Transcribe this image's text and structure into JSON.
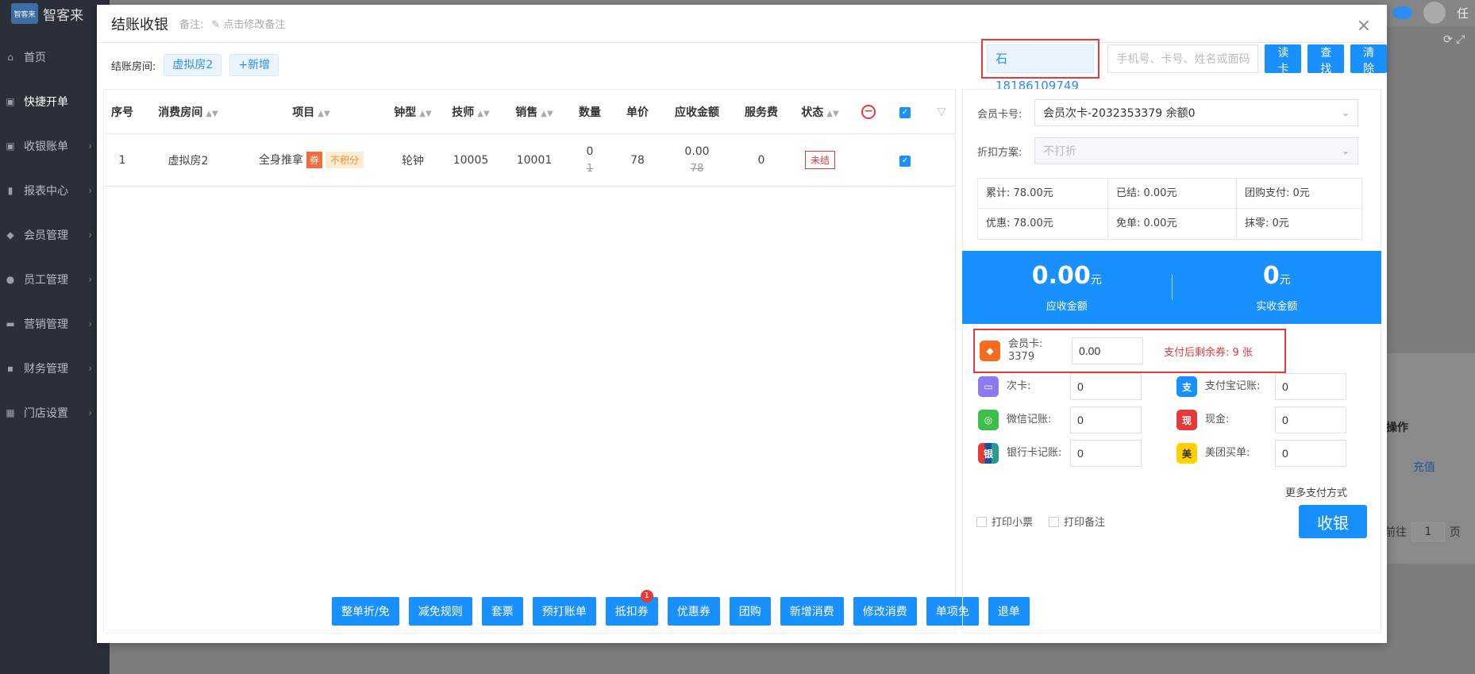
{
  "app": {
    "logo_badge": "智客来",
    "name": "智客来",
    "user_initial": "任",
    "sidebar": [
      {
        "label": "首页",
        "icon": "home-icon"
      },
      {
        "label": "快捷开单",
        "icon": "wallet-icon"
      },
      {
        "label": "收银账单",
        "icon": "wallet-icon"
      },
      {
        "label": "报表中心",
        "icon": "bar-chart-icon"
      },
      {
        "label": "会员管理",
        "icon": "diamond-icon"
      },
      {
        "label": "员工管理",
        "icon": "user-icon"
      },
      {
        "label": "营销管理",
        "icon": "briefcase-icon"
      },
      {
        "label": "财务管理",
        "icon": "money-icon"
      },
      {
        "label": "门店设置",
        "icon": "grid-icon"
      }
    ],
    "bg_table": {
      "op_header": "操作",
      "recharge": "充值",
      "pager_goto": "前往",
      "pager_page": "1",
      "pager_unit": "页"
    }
  },
  "modal": {
    "title": "结账收银",
    "remark_label": "备注:",
    "remark_edit": "点击修改备注",
    "room_label": "结账房间:",
    "room_tag": "虚拟房2",
    "add_room": "+新增",
    "search": {
      "phone_chip": "石 18186109749",
      "placeholder": "手机号、卡号、姓名或面码",
      "read_card": "读卡",
      "find": "查找",
      "clear": "清除"
    },
    "table": {
      "headers": {
        "no": "序号",
        "room": "消费房间",
        "item": "项目",
        "clock": "钟型",
        "tech": "技师",
        "sales": "销售",
        "qty": "数量",
        "price": "单价",
        "receivable": "应收金额",
        "service_fee": "服务费",
        "status": "状态"
      },
      "rows": [
        {
          "no": "1",
          "room": "虚拟房2",
          "item": "全身推拿",
          "coupon_badge": "券",
          "point_badge": "不积分",
          "clock": "轮钟",
          "tech": "10005",
          "sales": "10001",
          "qty": "0",
          "qty_old": "1",
          "price": "78",
          "receivable": "0.00",
          "receivable_old": "78",
          "service_fee": "0",
          "status": "未结"
        }
      ]
    },
    "actions": [
      {
        "label": "整单折/免"
      },
      {
        "label": "减免规则"
      },
      {
        "label": "套票"
      },
      {
        "label": "预打账单"
      },
      {
        "label": "抵扣券",
        "badge": "1"
      },
      {
        "label": "优惠券"
      },
      {
        "label": "团购"
      },
      {
        "label": "新增消费"
      },
      {
        "label": "修改消费"
      },
      {
        "label": "单项免"
      },
      {
        "label": "退单"
      }
    ],
    "right": {
      "card_label": "会员卡号:",
      "card_value": "会员次卡-2032353379 余额0",
      "discount_label": "折扣方案:",
      "discount_value": "不打折",
      "summary": {
        "total": "累计: 78.00元",
        "settled": "已结: 0.00元",
        "group_pay": "团购支付: 0元",
        "discount": "优惠: 78.00元",
        "free": "免单: 0.00元",
        "rounding": "抹零: 0元"
      },
      "receivable_amount": "0.00",
      "receivable_unit": "元",
      "receivable_label": "应收金额",
      "received_amount": "0",
      "received_unit": "元",
      "received_label": "实收金额",
      "member_pay": {
        "label_line1": "会员卡:",
        "label_line2": "3379",
        "value": "0.00",
        "remain": "支付后剩余券:   9 张"
      },
      "payments": {
        "times_card": {
          "label": "次卡:",
          "value": "0"
        },
        "alipay": {
          "label": "支付宝记账:",
          "value": "0"
        },
        "wechat": {
          "label": "微信记账:",
          "value": "0"
        },
        "cash": {
          "label": "现金:",
          "value": "0"
        },
        "bankcard": {
          "label": "银行卡记账:",
          "value": "0"
        },
        "meituan": {
          "label": "美团买单:",
          "value": "0"
        }
      },
      "more_pay": "更多支付方式",
      "print_receipt": "打印小票",
      "print_remark": "打印备注",
      "checkout": "收银"
    }
  },
  "colors": {
    "primary": "#1890ff",
    "danger": "#e43a3a",
    "sidebar": "#2b2f3a"
  }
}
